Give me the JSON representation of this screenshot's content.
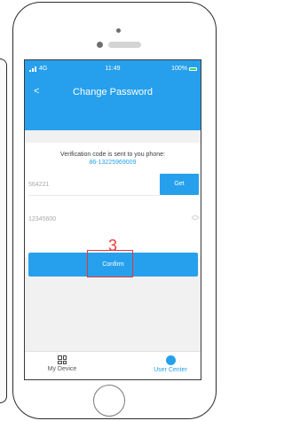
{
  "status_bar": {
    "network": "4G",
    "time": "11:49",
    "battery": "100%"
  },
  "header": {
    "back_icon": "back-arrow-icon",
    "title": "Change Password"
  },
  "verification": {
    "notice": "Verification code is sent to you phone:",
    "phone": "86-13225969009"
  },
  "code_input": {
    "value": "564221"
  },
  "get_button": {
    "label": "Get"
  },
  "password_input": {
    "value": "12345600"
  },
  "annotation": {
    "step": "3"
  },
  "confirm_button": {
    "label": "Confirm"
  },
  "tab_bar": {
    "device": "My Device",
    "user": "User Center"
  },
  "colors": {
    "accent": "#26a0ec",
    "annotation": "#e53935"
  }
}
